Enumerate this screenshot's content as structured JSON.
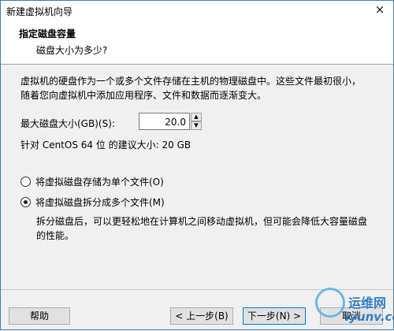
{
  "window": {
    "title": "新建虚拟机向导",
    "close": "×"
  },
  "header": {
    "title": "指定磁盘容量",
    "subtitle": "磁盘大小为多少?"
  },
  "content": {
    "description": "虚拟机的硬盘作为一个或多个文件存储在主机的物理磁盘中。这些文件最初很小，随着您向虚拟机中添加应用程序、文件和数据而逐渐变大。",
    "max_size_label": "最大磁盘大小(GB)(S):",
    "max_size_value": "20.0",
    "recommended": "针对 CentOS 64 位 的建议大小: 20 GB",
    "options": [
      {
        "label": "将虚拟磁盘存储为单个文件(O)",
        "selected": false
      },
      {
        "label": "将虚拟磁盘拆分成多个文件(M)",
        "selected": true
      }
    ],
    "split_note": "拆分磁盘后，可以更轻松地在计算机之间移动虚拟机，但可能会降低大容量磁盘的性能。"
  },
  "footer": {
    "help": "帮助",
    "back": "< 上一步(B)",
    "next": "下一步(N) >",
    "cancel": "取消"
  },
  "watermark": {
    "cn": "运维网",
    "en": "iyunv.com"
  },
  "icons": {
    "spin_up": "▲",
    "spin_down": "▼"
  }
}
